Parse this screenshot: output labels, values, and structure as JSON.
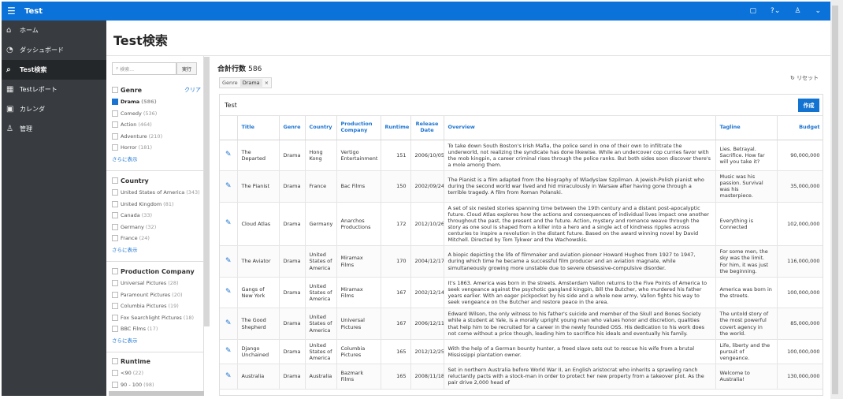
{
  "header": {
    "title": "Test"
  },
  "sidebar": {
    "items": [
      {
        "label": "ホーム",
        "icon": "home-icon"
      },
      {
        "label": "ダッシュボード",
        "icon": "dashboard-icon"
      },
      {
        "label": "Test検索",
        "icon": "search-list-icon"
      },
      {
        "label": "Testレポート",
        "icon": "report-icon"
      },
      {
        "label": "カレンダ",
        "icon": "calendar-icon"
      },
      {
        "label": "管理",
        "icon": "admin-icon"
      }
    ]
  },
  "page": {
    "title": "Test検索"
  },
  "search": {
    "placeholder": "検索...",
    "button": "実行"
  },
  "facets": {
    "genre": {
      "title": "Genre",
      "clear": "クリア",
      "items": [
        {
          "label": "Drama",
          "count": "(586)"
        },
        {
          "label": "Comedy",
          "count": "(536)"
        },
        {
          "label": "Action",
          "count": "(464)"
        },
        {
          "label": "Adventure",
          "count": "(210)"
        },
        {
          "label": "Horror",
          "count": "(181)"
        }
      ],
      "more": "さらに表示"
    },
    "country": {
      "title": "Country",
      "items": [
        {
          "label": "United States of America",
          "count": "(343)"
        },
        {
          "label": "United Kingdom",
          "count": "(81)"
        },
        {
          "label": "Canada",
          "count": "(33)"
        },
        {
          "label": "Germany",
          "count": "(32)"
        },
        {
          "label": "France",
          "count": "(24)"
        }
      ],
      "more": "さらに表示"
    },
    "company": {
      "title": "Production Company",
      "items": [
        {
          "label": "Universal Pictures",
          "count": "(28)"
        },
        {
          "label": "Paramount Pictures",
          "count": "(20)"
        },
        {
          "label": "Columbia Pictures",
          "count": "(19)"
        },
        {
          "label": "Fox Searchlight Pictures",
          "count": "(18)"
        },
        {
          "label": "BBC Films",
          "count": "(17)"
        }
      ],
      "more": "さらに表示"
    },
    "runtime": {
      "title": "Runtime",
      "items": [
        {
          "label": "<90",
          "count": "(22)"
        },
        {
          "label": "90 - 100",
          "count": "(98)"
        }
      ]
    }
  },
  "results": {
    "total_label": "合計行数",
    "total": "586",
    "chip_label": "Genre",
    "chip_value": "Drama",
    "reset": "リセット"
  },
  "report": {
    "title": "Test",
    "create_label": "作成",
    "columns": [
      "Title",
      "Genre",
      "Country",
      "Production Company",
      "Runtime",
      "Release Date",
      "Overview",
      "Tagline",
      "Budget"
    ],
    "rows": [
      [
        "The Departed",
        "Drama",
        "Hong Kong",
        "Vertigo Entertainment",
        "151",
        "2006/10/05",
        "To take down South Boston's Irish Mafia, the police send in one of their own to infiltrate the underworld, not realizing the syndicate has done likewise. While an undercover cop curries favor with the mob kingpin, a career criminal rises through the police ranks. But both sides soon discover there's a mole among them.",
        "Lies. Betrayal. Sacrifice. How far will you take it?",
        "90,000,000"
      ],
      [
        "The Pianist",
        "Drama",
        "France",
        "Bac Films",
        "150",
        "2002/09/24",
        "The Pianist is a film adapted from the biography of Wladyslaw Szpilman. A Jewish-Polish pianist who during the second world war lived and hid miraculously in Warsaw after having gone through a terrible tragedy. A film from Roman Polanski.",
        "Music was his passion. Survival was his masterpiece.",
        "35,000,000"
      ],
      [
        "Cloud Atlas",
        "Drama",
        "Germany",
        "Anarchos Productions",
        "172",
        "2012/10/26",
        "A set of six nested stories spanning time between the 19th century and a distant post-apocalyptic future. Cloud Atlas explores how the actions and consequences of individual lives impact one another throughout the past, the present and the future. Action, mystery and romance weave through the story as one soul is shaped from a killer into a hero and a single act of kindness ripples across centuries to inspire a revolution in the distant future. Based on the award winning novel by David Mitchell. Directed by Tom Tykwer and the Wachowskis.",
        "Everything is Connected",
        "102,000,000"
      ],
      [
        "The Aviator",
        "Drama",
        "United States of America",
        "Miramax Films",
        "170",
        "2004/12/17",
        "A biopic depicting the life of filmmaker and aviation pioneer Howard Hughes from 1927 to 1947, during which time he became a successful film producer and an aviation magnate, while simultaneously growing more unstable due to severe obsessive-compulsive disorder.",
        "For some men, the sky was the limit. For him, it was just the beginning.",
        "116,000,000"
      ],
      [
        "Gangs of New York",
        "Drama",
        "United States of America",
        "Miramax Films",
        "167",
        "2002/12/14",
        "It's 1863. America was born in the streets. Amsterdam Vallon returns to the Five Points of America to seek vengeance against the psychotic gangland kingpin, Bill the Butcher, who murdered his father years earlier. With an eager pickpocket by his side and a whole new army, Vallon fights his way to seek vengeance on the Butcher and restore peace in the area.",
        "America was born in the streets.",
        "100,000,000"
      ],
      [
        "The Good Shepherd",
        "Drama",
        "United States of America",
        "Universal Pictures",
        "167",
        "2006/12/11",
        "Edward Wilson, the only witness to his father's suicide and member of the Skull and Bones Society while a student at Yale, is a morally upright young man who values honor and discretion, qualities that help him to be recruited for a career in the newly founded OSS. His dedication to his work does not come without a price though, leading him to sacrifice his ideals and eventually his family.",
        "The untold story of the most powerful covert agency in the world.",
        "85,000,000"
      ],
      [
        "Django Unchained",
        "Drama",
        "United States of America",
        "Columbia Pictures",
        "165",
        "2012/12/25",
        "With the help of a German bounty hunter, a freed slave sets out to rescue his wife from a brutal Mississippi plantation owner.",
        "Life, liberty and the pursuit of vengeance.",
        "100,000,000"
      ],
      [
        "Australia",
        "Drama",
        "Australia",
        "Bazmark Films",
        "165",
        "2008/11/18",
        "Set in northern Australia before World War II, an English aristocrat who inherits a sprawling ranch reluctantly pacts with a stock-man in order to protect her new property from a takeover plot. As the pair drive 2,000 head of",
        "Welcome to Australia!",
        "130,000,000"
      ]
    ]
  }
}
